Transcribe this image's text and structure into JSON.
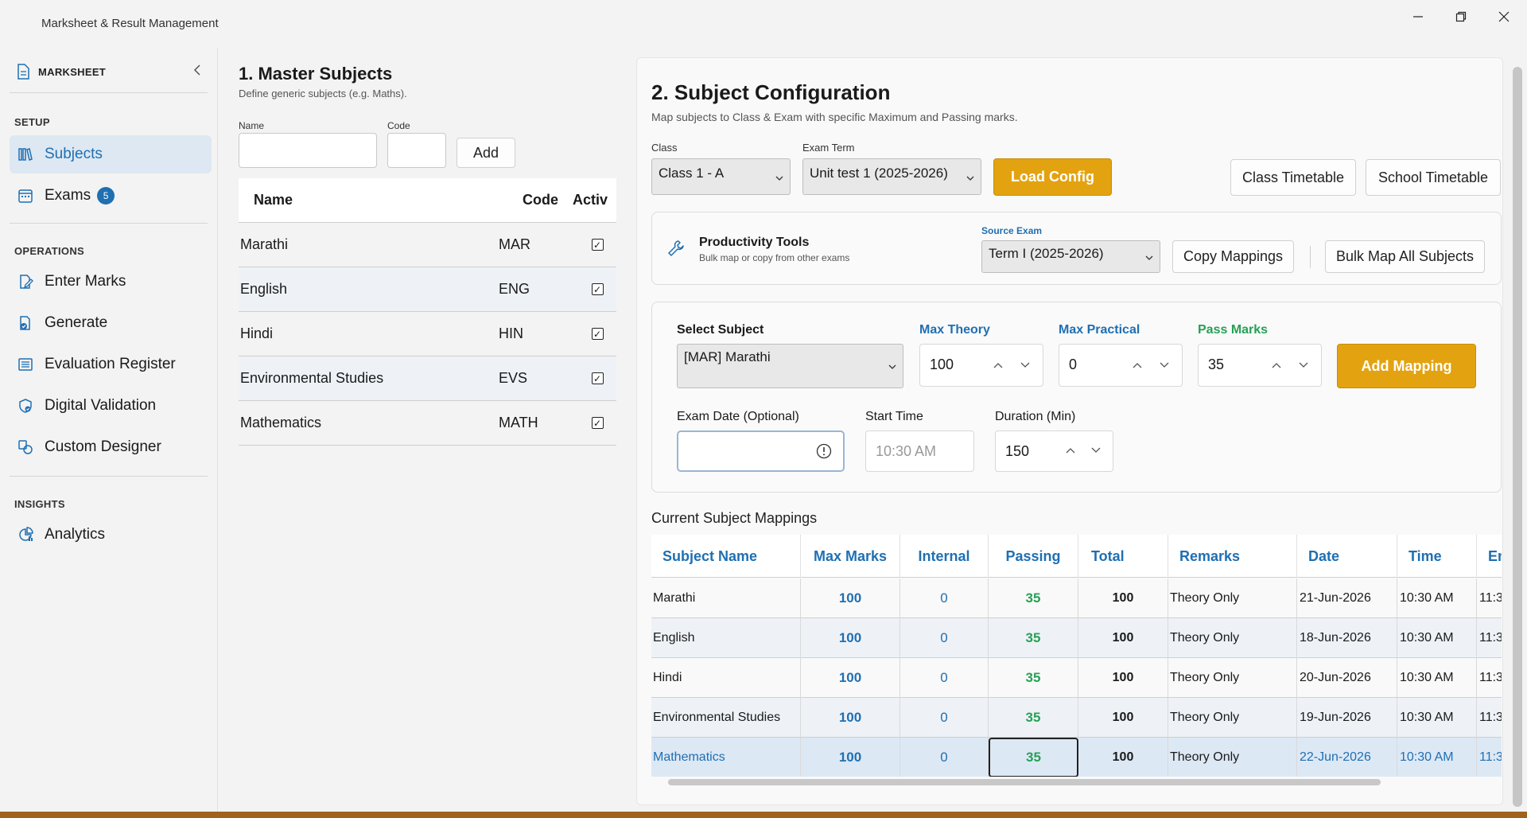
{
  "window": {
    "title": "Marksheet & Result Management",
    "minimize": "—",
    "maximize": "❐",
    "close": "✕"
  },
  "sidebar": {
    "brand": "MARKSHEET",
    "collapse": "‹",
    "sections": [
      {
        "label": "SETUP"
      },
      {
        "label": "OPERATIONS"
      },
      {
        "label": "INSIGHTS"
      }
    ],
    "items": [
      {
        "label": "Subjects",
        "icon": "books-icon",
        "active": true
      },
      {
        "label": "Exams",
        "icon": "calendar-icon",
        "badge": "5"
      },
      {
        "label": "Enter Marks",
        "icon": "edit-icon"
      },
      {
        "label": "Generate",
        "icon": "document-check-icon"
      },
      {
        "label": "Evaluation Register",
        "icon": "list-icon"
      },
      {
        "label": "Digital Validation",
        "icon": "shield-check-icon"
      },
      {
        "label": "Custom Designer",
        "icon": "designer-icon"
      },
      {
        "label": "Analytics",
        "icon": "analytics-icon"
      }
    ]
  },
  "master": {
    "title": "1. Master Subjects",
    "subtitle": "Define generic subjects (e.g. Maths).",
    "name_label": "Name",
    "code_label": "Code",
    "add_label": "Add",
    "headers": {
      "name": "Name",
      "code": "Code",
      "active": "Activ"
    },
    "rows": [
      {
        "name": "Marathi",
        "code": "MAR",
        "active": "✓"
      },
      {
        "name": "English",
        "code": "ENG",
        "active": "✓"
      },
      {
        "name": "Hindi",
        "code": "HIN",
        "active": "✓"
      },
      {
        "name": "Environmental Studies",
        "code": "EVS",
        "active": "✓"
      },
      {
        "name": "Mathematics",
        "code": "MATH",
        "active": "✓"
      }
    ]
  },
  "config": {
    "title": "2. Subject Configuration",
    "subtitle": "Map subjects to Class & Exam with specific Maximum and Passing marks.",
    "class_label": "Class",
    "class_value": "Class 1 - A",
    "term_label": "Exam Term",
    "term_value": "Unit test 1 (2025-2026)",
    "load_label": "Load Config",
    "class_timetable": "Class Timetable",
    "school_timetable": "School Timetable",
    "tools_title": "Productivity Tools",
    "tools_sub": "Bulk map or copy from other exams",
    "source_label": "Source Exam",
    "source_value": "Term I (2025-2026)",
    "copy_label": "Copy Mappings",
    "bulk_label": "Bulk Map All Subjects",
    "select_subject_label": "Select Subject",
    "select_subject_value": "[MAR] Marathi",
    "max_theory_label": "Max Theory",
    "max_theory_value": "100",
    "max_practical_label": "Max Practical",
    "max_practical_value": "0",
    "pass_label": "Pass Marks",
    "pass_value": "35",
    "add_mapping_label": "Add Mapping",
    "exam_date_label": "Exam Date (Optional)",
    "start_time_label": "Start Time",
    "start_time_placeholder": "10:30 AM",
    "duration_label": "Duration (Min)",
    "duration_value": "150",
    "mappings_title": "Current Subject Mappings"
  },
  "mappings": {
    "headers": [
      "Subject Name",
      "Max Marks",
      "Internal",
      "Passing",
      "Total",
      "Remarks",
      "Date",
      "Time",
      "En"
    ],
    "rows": [
      {
        "subject": "Marathi",
        "max": "100",
        "internal": "0",
        "passing": "35",
        "total": "100",
        "remarks": "Theory Only",
        "date": "21-Jun-2026",
        "time": "10:30 AM",
        "end": "11:3"
      },
      {
        "subject": "English",
        "max": "100",
        "internal": "0",
        "passing": "35",
        "total": "100",
        "remarks": "Theory Only",
        "date": "18-Jun-2026",
        "time": "10:30 AM",
        "end": "11:3"
      },
      {
        "subject": "Hindi",
        "max": "100",
        "internal": "0",
        "passing": "35",
        "total": "100",
        "remarks": "Theory Only",
        "date": "20-Jun-2026",
        "time": "10:30 AM",
        "end": "11:3"
      },
      {
        "subject": "Environmental Studies",
        "max": "100",
        "internal": "0",
        "passing": "35",
        "total": "100",
        "remarks": "Theory Only",
        "date": "19-Jun-2026",
        "time": "10:30 AM",
        "end": "11:3"
      },
      {
        "subject": "Mathematics",
        "max": "100",
        "internal": "0",
        "passing": "35",
        "total": "100",
        "remarks": "Theory Only",
        "date": "22-Jun-2026",
        "time": "10:30 AM",
        "end": "11:3"
      }
    ]
  },
  "colors": {
    "accent": "#1f6fb2",
    "gold": "#e3a310",
    "green": "#27a055"
  }
}
